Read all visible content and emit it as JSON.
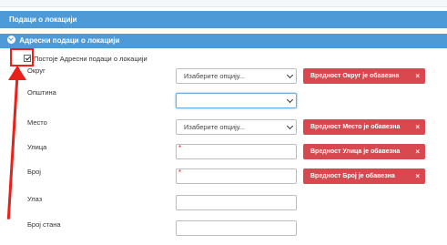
{
  "section_title": "Подаци о локацији",
  "subsection_title": "Адресни подаци о локацији",
  "checkbox": {
    "label": "Постоје Адресни подаци о локацији",
    "checked": true
  },
  "fields": {
    "okrug": {
      "label": "Округ",
      "value": "Изаберите опцију...",
      "error": "Вредност Округ је обавезна"
    },
    "opstina": {
      "label": "Општина",
      "value": ""
    },
    "mesto": {
      "label": "Место",
      "value": "Изаберите опцију...",
      "error": "Вредност Место је обавезна"
    },
    "ulica": {
      "label": "Улица",
      "required_mark": "*",
      "error": "Вредност Улица је обавезна"
    },
    "broj": {
      "label": "Број",
      "required_mark": "*",
      "error": "Вредност Број је обавезна"
    },
    "ulaz": {
      "label": "Улаз"
    },
    "broj_stana": {
      "label": "Број стана"
    }
  },
  "close_glyph": "×",
  "colors": {
    "header": "#4e9ad6",
    "error": "#d9474f",
    "annotation": "#e8211a"
  }
}
